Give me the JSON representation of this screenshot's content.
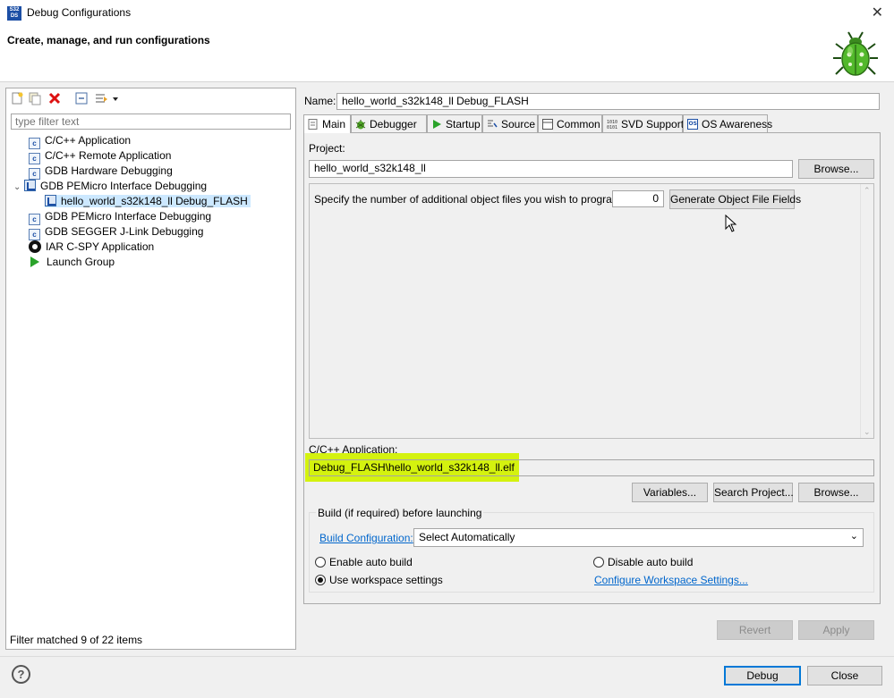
{
  "window": {
    "title": "Debug Configurations",
    "icon_text": "S32\nDS",
    "header_title": "Create, manage, and run configurations",
    "close_glyph": "✕"
  },
  "left": {
    "toolbar_icons": [
      "new-configuration-icon",
      "duplicate-icon",
      "delete-icon",
      "collapse-all-icon",
      "filter-icon",
      "dropdown-arrow-icon"
    ],
    "filter_placeholder": "type filter text",
    "tree": [
      {
        "label": "C/C++ Application",
        "icon": "c-icon",
        "level": 0
      },
      {
        "label": "C/C++ Remote Application",
        "icon": "c-icon",
        "level": 0
      },
      {
        "label": "GDB Hardware Debugging",
        "icon": "c-icon",
        "level": 0
      },
      {
        "label": "GDB PEMicro Interface Debugging",
        "icon": "gdb-icon",
        "level": 0,
        "expanded": true
      },
      {
        "label": "hello_world_s32k148_ll Debug_FLASH",
        "icon": "gdb-icon",
        "level": 1,
        "selected": true
      },
      {
        "label": "GDB PEMicro Interface Debugging",
        "icon": "c-icon",
        "level": 0
      },
      {
        "label": "GDB SEGGER J-Link Debugging",
        "icon": "c-icon",
        "level": 0
      },
      {
        "label": "IAR C-SPY Application",
        "icon": "iar-icon",
        "level": 0
      },
      {
        "label": "Launch Group",
        "icon": "launch-icon",
        "level": 0
      }
    ],
    "filter_status": "Filter matched 9 of 22 items"
  },
  "right": {
    "name_label": "Name:",
    "name_value": "hello_world_s32k148_ll Debug_FLASH",
    "tabs": [
      {
        "label": "Main",
        "icon": "main-tab-icon",
        "active": true
      },
      {
        "label": "Debugger",
        "icon": "debugger-tab-icon"
      },
      {
        "label": "Startup",
        "icon": "startup-tab-icon"
      },
      {
        "label": "Source",
        "icon": "source-tab-icon"
      },
      {
        "label": "Common",
        "icon": "common-tab-icon"
      },
      {
        "label": "SVD Support",
        "icon": "svd-tab-icon"
      },
      {
        "label": "OS Awareness",
        "icon": "os-awareness-tab-icon"
      }
    ],
    "project_label": "Project:",
    "project_value": "hello_world_s32k148_ll",
    "browse_label": "Browse...",
    "object_files_label": "Specify the number of additional object files you wish to program:",
    "object_files_value": "0",
    "generate_label": "Generate Object File Fields",
    "app_label": "C/C++ Application:",
    "app_value": "Debug_FLASH\\hello_world_s32k148_ll.elf",
    "highlight_color": "#d4f20f",
    "variables_label": "Variables...",
    "search_project_label": "Search Project...",
    "browse2_label": "Browse...",
    "build_group_label": "Build (if required) before launching",
    "build_config_link": "Build Configuration:",
    "build_config_value": "Select Automatically",
    "enable_auto_build": "Enable auto build",
    "disable_auto_build": "Disable auto build",
    "use_workspace": "Use workspace settings",
    "configure_workspace": "Configure Workspace Settings...",
    "selected_build_option": "Use workspace settings",
    "revert_label": "Revert",
    "apply_label": "Apply"
  },
  "footer": {
    "help_glyph": "?",
    "debug_label": "Debug",
    "close_label": "Close"
  },
  "colors": {
    "accent": "#0078d7",
    "link": "#0066cc",
    "selection": "#cce8ff"
  }
}
